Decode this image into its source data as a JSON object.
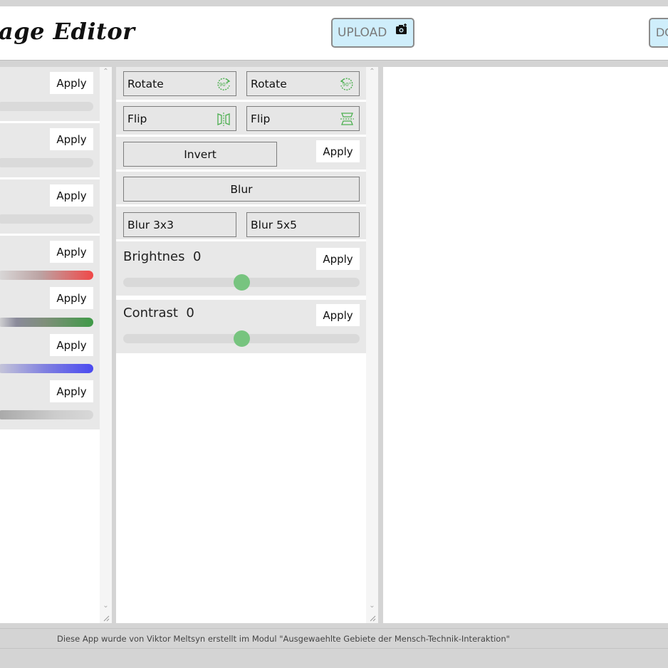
{
  "header": {
    "logo_text": "age Editor",
    "upload_label": "UPLOAD",
    "download_label": "DO"
  },
  "left_panel": {
    "sections": [
      {
        "apply_label": "Apply",
        "bar_color": "#dadada"
      },
      {
        "apply_label": "Apply",
        "bar_color": "#dadada"
      },
      {
        "apply_label": "Apply",
        "bar_color": "#dadada"
      },
      {
        "apply_label": "Apply",
        "bar_color": "#f04848"
      },
      {
        "apply_label": "Apply",
        "bar_color": "#3f9a47"
      },
      {
        "apply_label": "Apply",
        "bar_color": "#4a4af0"
      },
      {
        "apply_label": "Apply",
        "bar_color": "#a8a8a8"
      }
    ]
  },
  "middle_panel": {
    "rotate_right_label": "Rotate",
    "rotate_left_label": "Rotate",
    "rotate_icon_text": "90°",
    "flip_horizontal_label": "Flip",
    "flip_vertical_label": "Flip",
    "invert_label": "Invert",
    "invert_apply_label": "Apply",
    "blur_label": "Blur",
    "blur3_label": "Blur 3x3",
    "blur5_label": "Blur 5x5",
    "brightness": {
      "label": "Brightnes",
      "value": "0",
      "apply_label": "Apply"
    },
    "contrast": {
      "label": "Contrast",
      "value": "0",
      "apply_label": "Apply"
    },
    "accent_color": "#77c47f"
  },
  "footer": {
    "text": "Diese App wurde von Viktor Meltsyn erstellt im Modul \"Ausgewaehlte Gebiete der Mensch-Technik-Interaktion\""
  }
}
